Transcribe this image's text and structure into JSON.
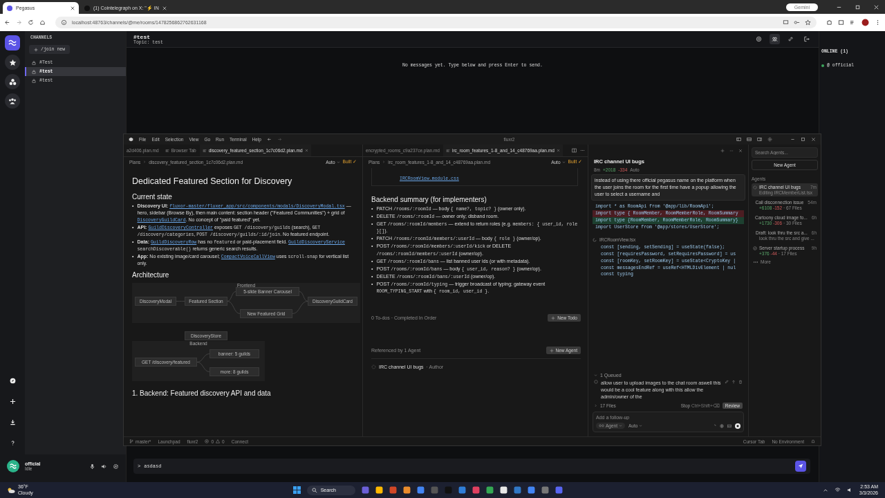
{
  "browser": {
    "tabs": [
      {
        "title": "Pegasus",
        "selected": true
      },
      {
        "title": "(1) Cointelegraph on X: \"⚡ IN",
        "selected": false
      }
    ],
    "gemini": "Gemini",
    "url": "localhost:48763/channels/@me/rooms/1478256862762631168"
  },
  "app": {
    "channels_heading": "CHANNELS",
    "join_button": "/join new",
    "channels": [
      {
        "name": "#Test",
        "selected": false
      },
      {
        "name": "#test",
        "selected": true
      },
      {
        "name": "#test",
        "selected": false
      }
    ],
    "room": {
      "name": "#test",
      "topic": "Topic: test",
      "empty": "No messages yet. Type below and press Enter to send."
    },
    "online_heading": "ONLINE (1)",
    "members": [
      {
        "name": "@ official",
        "online": true
      }
    ],
    "user": {
      "name": "official",
      "status": "Idle"
    },
    "composer": {
      "prompt": ">",
      "value": "asdasd"
    }
  },
  "editor": {
    "menu": [
      "File",
      "Edit",
      "Selection",
      "View",
      "Go",
      "Run",
      "Terminal",
      "Help"
    ],
    "title": "fluxr2",
    "left": {
      "tabs": [
        {
          "title": "a2d406.plan.md",
          "selected": false
        },
        {
          "title": "Browser Tab",
          "selected": false
        },
        {
          "title": "discovery_featured_section_1c7c06d2.plan.md",
          "selected": true
        }
      ],
      "crumbs": [
        "Plans",
        "discovery_featured_section_1c7c06d2.plan.md"
      ],
      "mode": "Auto",
      "status": "Built ✓",
      "title": "Dedicated Featured Section for Discovery",
      "section1": "Current state",
      "bullets": [
        {
          "marker": "•",
          "parts": [
            {
              "kind": "bold",
              "text": "Discovery UI: "
            },
            {
              "kind": "link",
              "text": "fluxor-master/fluxer_app/src/components/modals/DiscoveryModal.tsx"
            },
            {
              "kind": "text",
              "text": " — hero, sidebar (Browse By), then main content: section header (\"Featured Communities\") + grid of "
            },
            {
              "kind": "link",
              "text": "DiscoveryGuildCard"
            },
            {
              "kind": "text",
              "text": ". No concept of \"paid featured\" yet."
            }
          ]
        },
        {
          "marker": "•",
          "parts": [
            {
              "kind": "bold",
              "text": "API: "
            },
            {
              "kind": "link",
              "text": "GuildDiscoveryController"
            },
            {
              "kind": "text",
              "text": " exposes "
            },
            {
              "kind": "code",
              "text": "GET /discovery/guilds"
            },
            {
              "kind": "text",
              "text": " (search), "
            },
            {
              "kind": "code",
              "text": "GET /discovery/categories"
            },
            {
              "kind": "text",
              "text": ", "
            },
            {
              "kind": "code",
              "text": "POST /discovery/guilds/:id/join"
            },
            {
              "kind": "text",
              "text": ". No featured endpoint."
            }
          ]
        },
        {
          "marker": "•",
          "parts": [
            {
              "kind": "bold",
              "text": "Data: "
            },
            {
              "kind": "link",
              "text": "GuildDiscoveryRow"
            },
            {
              "kind": "text",
              "text": " has no "
            },
            {
              "kind": "code",
              "text": "featured"
            },
            {
              "kind": "text",
              "text": " or paid-placement field. "
            },
            {
              "kind": "link",
              "text": "GuildDiscoveryService"
            },
            {
              "kind": "code",
              "text": " searchDiscoverable()"
            },
            {
              "kind": "text",
              "text": " returns generic search results."
            }
          ]
        },
        {
          "marker": "•",
          "parts": [
            {
              "kind": "bold",
              "text": "App: "
            },
            {
              "kind": "text",
              "text": "No existing image/card carousel; "
            },
            {
              "kind": "link",
              "text": "CompactVoiceCallView"
            },
            {
              "kind": "text",
              "text": " uses "
            },
            {
              "kind": "code",
              "text": "scroll-snap"
            },
            {
              "kind": "text",
              "text": " for vertical list only."
            }
          ]
        }
      ],
      "section2": "Architecture",
      "diagram": {
        "groups": [
          "Frontend",
          "Backend"
        ],
        "nodes": [
          "DiscoveryModal",
          "Featured Section",
          "5-slide Banner Carousel",
          "New Featured Grid",
          "DiscoveryGuildCard",
          "DiscoveryStore",
          "GET /discovery/featured",
          "banner: 5 guilds",
          "more: 8 guilds"
        ]
      },
      "section3": "1. Backend: Featured discovery API and data"
    },
    "right": {
      "tabs": [
        {
          "title": "encrypted_rooms_c9a237ce.plan.md",
          "selected": false
        },
        {
          "title": "irc_room_features_1-8_and_14_c48769aa.plan.md",
          "selected": true
        }
      ],
      "crumbs": [
        "Plans",
        "irc_room_features_1-8_and_14_c48769aa.plan.md"
      ],
      "mode": "Auto",
      "status": "Built ✓",
      "top_link": "IRCRoomView.module.css",
      "title": "Backend summary (for implementers)",
      "bullets": [
        {
          "marker": "•",
          "parts": [
            {
              "kind": "text",
              "text": "PATCH "
            },
            {
              "kind": "code",
              "text": "/rooms/:roomId"
            },
            {
              "kind": "text",
              "text": " — body "
            },
            {
              "kind": "code",
              "text": "{ name?, topic? }"
            },
            {
              "kind": "text",
              "text": " (owner only)."
            }
          ]
        },
        {
          "marker": "•",
          "parts": [
            {
              "kind": "text",
              "text": "DELETE "
            },
            {
              "kind": "code",
              "text": "/rooms/:roomId"
            },
            {
              "kind": "text",
              "text": " — owner only; disband room."
            }
          ]
        },
        {
          "marker": "•",
          "parts": [
            {
              "kind": "text",
              "text": "GET "
            },
            {
              "kind": "code",
              "text": "/rooms/:roomId/members"
            },
            {
              "kind": "text",
              "text": " — extend to return roles (e.g. "
            },
            {
              "kind": "code",
              "text": "members: { user_id, role }[]"
            },
            {
              "kind": "text",
              "text": ")."
            }
          ]
        },
        {
          "marker": "•",
          "parts": [
            {
              "kind": "text",
              "text": "PATCH "
            },
            {
              "kind": "code",
              "text": "/rooms/:roomId/members/:userId"
            },
            {
              "kind": "text",
              "text": " — body "
            },
            {
              "kind": "code",
              "text": "{ role }"
            },
            {
              "kind": "text",
              "text": " (owner/op)."
            }
          ]
        },
        {
          "marker": "•",
          "parts": [
            {
              "kind": "text",
              "text": "POST "
            },
            {
              "kind": "code",
              "text": "/rooms/:roomId/members/:userId/kick"
            },
            {
              "kind": "text",
              "text": " or DELETE "
            },
            {
              "kind": "code",
              "text": "/rooms/:roomId/members/:userId"
            },
            {
              "kind": "text",
              "text": " (owner/op)."
            }
          ]
        },
        {
          "marker": "•",
          "parts": [
            {
              "kind": "text",
              "text": "GET "
            },
            {
              "kind": "code",
              "text": "/rooms/:roomId/bans"
            },
            {
              "kind": "text",
              "text": " — list banned user ids (or with metadata)."
            }
          ]
        },
        {
          "marker": "•",
          "parts": [
            {
              "kind": "text",
              "text": "POST "
            },
            {
              "kind": "code",
              "text": "/rooms/:roomId/bans"
            },
            {
              "kind": "text",
              "text": " — body "
            },
            {
              "kind": "code",
              "text": "{ user_id, reason? }"
            },
            {
              "kind": "text",
              "text": " (owner/op)."
            }
          ]
        },
        {
          "marker": "•",
          "parts": [
            {
              "kind": "text",
              "text": "DELETE "
            },
            {
              "kind": "code",
              "text": "/rooms/:roomId/bans/:userId"
            },
            {
              "kind": "text",
              "text": " (owner/op)."
            }
          ]
        },
        {
          "marker": "•",
          "parts": [
            {
              "kind": "text",
              "text": "POST "
            },
            {
              "kind": "code",
              "text": "/rooms/:roomId/typing"
            },
            {
              "kind": "text",
              "text": " — trigger broadcast of typing; gateway event "
            },
            {
              "kind": "code",
              "text": "ROOM_TYPING_START"
            },
            {
              "kind": "text",
              "text": " with "
            },
            {
              "kind": "code",
              "text": "{ room_id, user_id }"
            },
            {
              "kind": "text",
              "text": "."
            }
          ]
        }
      ],
      "todos": "0 To-dos · Completed In Order",
      "new_todo": "New Todo",
      "referenced": "Referenced by 1 Agent",
      "new_agent": "New Agent",
      "agent_ref": "IRC channel UI bugs",
      "agent_role": "· Author"
    },
    "agent": {
      "title": "IRC channel UI bugs",
      "age": "8m",
      "added": "+2018",
      "removed": "-334",
      "mode": "Auto",
      "prompt": "instead of using there official pegasus name on the platform when the user joins the room for the first time have a popup allowing the user to select a username and",
      "files": [
        {
          "lines": [
            {
              "kind": "context",
              "text": "import * as RoomApi from '@app/lib/RoomApi';"
            },
            {
              "kind": "removed",
              "text": "import type { RoomMember, RoomMemberRole, RoomSummary"
            },
            {
              "kind": "added",
              "text": "import type {RoomMember, RoomMemberRole, RoomSummary}"
            },
            {
              "kind": "context",
              "text": "import UserStore from '@app/stores/UserStore';"
            }
          ]
        },
        {
          "name": "IRCRoomView.tsx",
          "lines": [
            {
              "kind": "context",
              "text": "const [sending, setSending] = useState(false);"
            },
            {
              "kind": "context",
              "text": "const [requiresPassword, setRequiresPassword] = us"
            },
            {
              "kind": "context",
              "text": "const [roomKey, setRoomKey] = useState<CryptoKey |"
            },
            {
              "kind": "context",
              "text": "const messagesEndRef = useRef<HTMLDivElement | nul"
            },
            {
              "kind": "context",
              "text": "const typing"
            }
          ]
        }
      ],
      "queued_heading": "1 Queued",
      "queued": "allow user to upload images to the chat room aswell this would be a cool feature along with this allow the admin/owner of the",
      "files_count": "17 Files",
      "stop": "Stop",
      "stop_keys": "Ctrl+Shift+⌫",
      "review": "Review",
      "followup_placeholder": "Add a follow-up",
      "agent_mode": "Agent",
      "model": "Auto"
    },
    "agents": {
      "search_placeholder": "Search Agents...",
      "new_agent": "New Agent",
      "heading": "Agents",
      "items": [
        {
          "kind": "running",
          "title": "IRC channel UI bugs",
          "sub": "Editing IRCMemberList.tsx",
          "time": "7m",
          "selected": true
        },
        {
          "kind": "done",
          "title": "Call disconnection issue",
          "added": "+6108",
          "removed": "-152",
          "files": "· 67 Files",
          "time": "54m",
          "selected": false
        },
        {
          "kind": "done",
          "title": "Cartoony cloud image fo...",
          "added": "+1730",
          "removed": "-306",
          "files": "· 30 Files",
          "time": "6h",
          "selected": false
        },
        {
          "kind": "draft",
          "title": "Draft: look thru the src a...",
          "sub": "look thru the src and give ...",
          "time": "6h",
          "selected": false
        },
        {
          "kind": "done",
          "title": "Server startup process",
          "added": "+376",
          "removed": "-44",
          "files": "· 17 Files",
          "time": "9h",
          "selected": false
        }
      ],
      "more": "More"
    },
    "statusbar": {
      "branch": "master*",
      "launchpad": "Launchpad",
      "project": "fluxr2",
      "errors": "0",
      "warnings": "0",
      "connect": "Connect",
      "cursor_tab": "Cursor Tab",
      "environment": "No Environment"
    }
  },
  "taskbar": {
    "temp": "36°F",
    "weather": "Cloudy",
    "search": "Search",
    "time": "2:53 AM",
    "date": "3/3/2026"
  }
}
